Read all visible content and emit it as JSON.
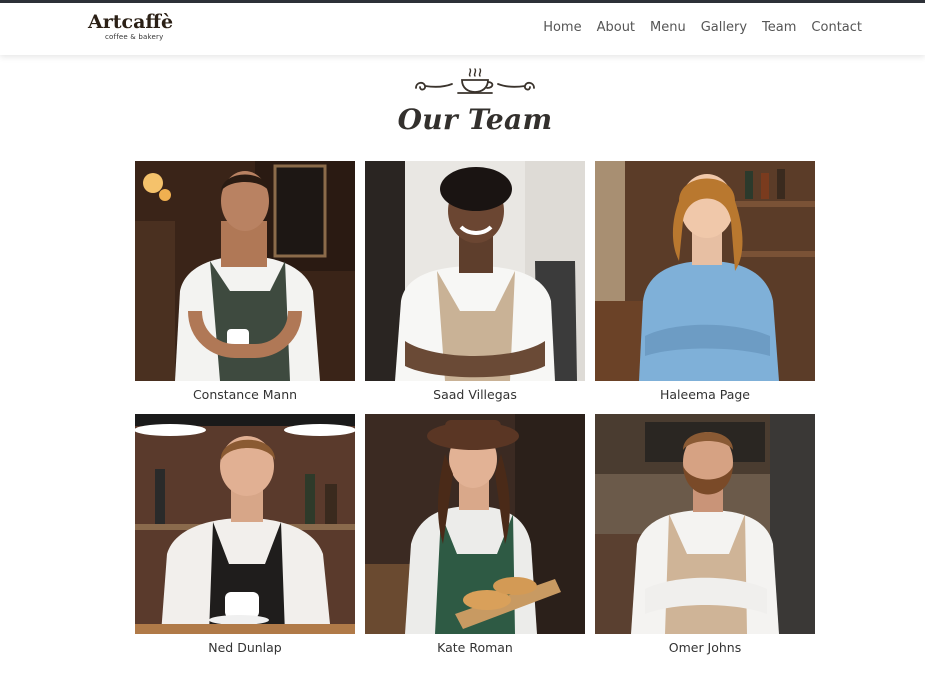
{
  "header": {
    "brand_name": "Artcaffè",
    "brand_tagline": "coffee & bakery",
    "nav": [
      "Home",
      "About",
      "Menu",
      "Gallery",
      "Team",
      "Contact"
    ]
  },
  "section": {
    "ornament_icon": "coffee-cup-flourish-icon",
    "title": "Our Team"
  },
  "team": [
    {
      "name": "Constance Mann"
    },
    {
      "name": "Saad Villegas"
    },
    {
      "name": "Haleema Page"
    },
    {
      "name": "Ned Dunlap"
    },
    {
      "name": "Kate Roman"
    },
    {
      "name": "Omer Johns"
    }
  ],
  "colors": {
    "topbar": "#2e3239",
    "brand": "#2b2016",
    "heading": "#33302d",
    "nav_text": "#555555"
  }
}
